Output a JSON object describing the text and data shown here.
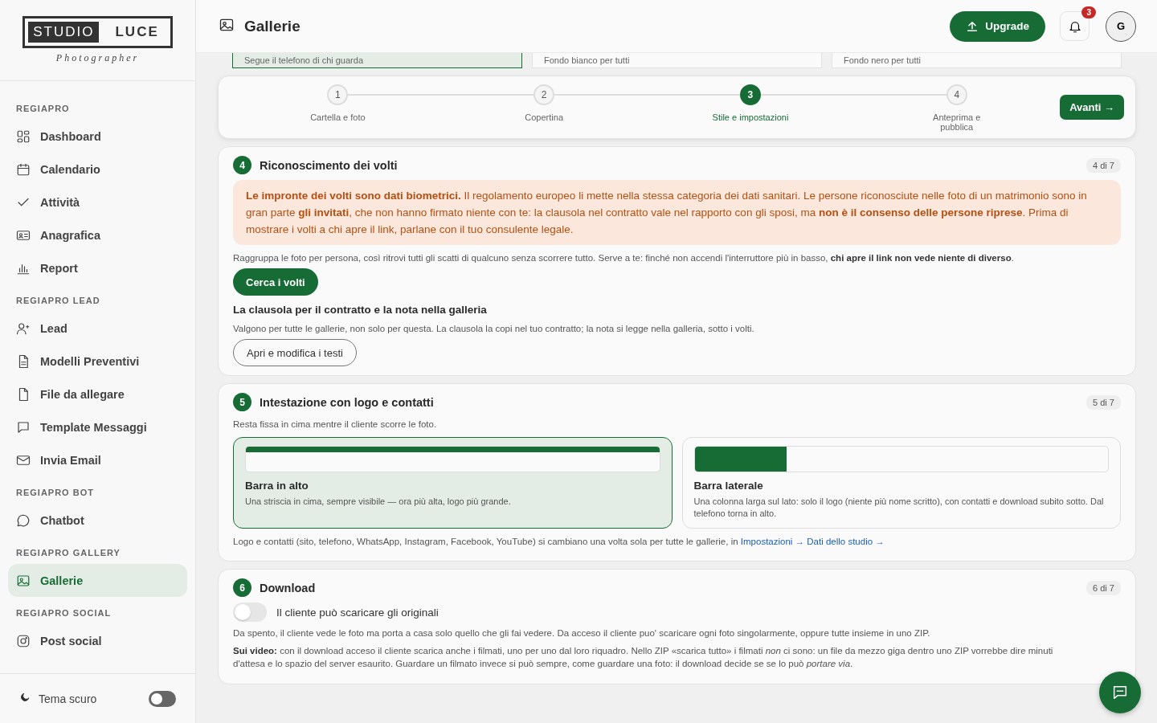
{
  "sidebar": {
    "logo": {
      "boxed": "STUDIO",
      "plain": "LUCE",
      "tagline": "Photographer"
    },
    "groups": [
      {
        "title": "REGIAPRO",
        "items": [
          {
            "label": "Dashboard",
            "selected": false
          },
          {
            "label": "Calendario",
            "selected": false
          },
          {
            "label": "Attività",
            "selected": false
          },
          {
            "label": "Anagrafica",
            "selected": false
          },
          {
            "label": "Report",
            "selected": false
          }
        ]
      },
      {
        "title": "REGIAPRO LEAD",
        "items": [
          {
            "label": "Lead",
            "selected": false
          },
          {
            "label": "Modelli Preventivi",
            "selected": false
          },
          {
            "label": "File da allegare",
            "selected": false
          },
          {
            "label": "Template Messaggi",
            "selected": false
          },
          {
            "label": "Invia Email",
            "selected": false
          }
        ]
      },
      {
        "title": "REGIAPRO BOT",
        "items": [
          {
            "label": "Chatbot",
            "selected": false
          }
        ]
      },
      {
        "title": "REGIAPRO GALLERY",
        "items": [
          {
            "label": "Gallerie",
            "selected": true
          }
        ]
      },
      {
        "title": "REGIAPRO SOCIAL",
        "items": [
          {
            "label": "Post social",
            "selected": false
          }
        ]
      }
    ],
    "dark_theme": {
      "label": "Tema scuro",
      "on": false
    }
  },
  "header": {
    "title": "Gallerie",
    "upgrade": "Upgrade",
    "notifications": "3",
    "avatar": "G"
  },
  "background_options": [
    {
      "text": "Segue il telefono di chi guarda",
      "selected": true
    },
    {
      "text": "Fondo bianco per tutti",
      "selected": false
    },
    {
      "text": "Fondo nero per tutti",
      "selected": false
    }
  ],
  "stepper": {
    "steps": [
      {
        "number": "1",
        "label": "Cartella e foto",
        "selected": false
      },
      {
        "number": "2",
        "label": "Copertina",
        "selected": false
      },
      {
        "number": "3",
        "label": "Stile e impostazioni",
        "selected": true
      },
      {
        "number": "4",
        "label": "Anteprima e pubblica",
        "selected": false
      }
    ],
    "next": "Avanti →"
  },
  "face_section": {
    "number": "4",
    "title": "Riconoscimento dei volti",
    "counter": "4 di 7",
    "warning": "**Le impronte dei volti sono dati biometrici.** Il regolamento europeo li mette nella stessa categoria dei dati sanitari. Le persone riconosciute nelle foto di un matrimonio sono in gran parte **gli invitati**, che non hanno firmato niente con te: la clausola nel contratto vale nel rapporto con gli sposi, ma **non è il consenso delle persone riprese**. Prima di mostrare i volti a chi apre il link, parlane con il tuo consulente legale.",
    "text": "Raggruppa le foto per persona, così ritrovi tutti gli scatti di qualcuno senza scorrere tutto. Serve a te: finché non accendi l'interruttore più in basso, **chi apre il link non vede niente di diverso**.",
    "button": "Cerca i volti",
    "subheading": "La clausola per il contratto e la nota nella galleria",
    "subtext": "Valgono per tutte le gallerie, non solo per questa. La clausola la copi nel tuo contratto; la nota si legge nella galleria, sotto i volti.",
    "edit_button": "Apri e modifica i testi"
  },
  "header_section": {
    "number": "5",
    "title": "Intestazione con logo e contatti",
    "counter": "5 di 7",
    "text": "Resta fissa in cima mentre il cliente scorre le foto.",
    "layouts": [
      {
        "kind": "top",
        "title": "Barra in alto",
        "text": "Una striscia in cima, sempre visibile — ora più alta, logo più grande.",
        "selected": true
      },
      {
        "kind": "side",
        "title": "Barra laterale",
        "text": "Una colonna larga sul lato: solo il logo (niente più nome scritto), con contatti e download subito sotto. Dal telefono torna in alto.",
        "selected": false
      }
    ],
    "note": "Logo e contatti (sito, telefono, WhatsApp, Instagram, Facebook, YouTube) si cambiano una volta sola per tutte le gallerie, in",
    "link": "Impostazioni → Dati dello studio →"
  },
  "download_section": {
    "number": "6",
    "title": "Download",
    "counter": "6 di 7",
    "toggle": {
      "label": "Il cliente può scaricare gli originali",
      "on": false
    },
    "paragraphs": [
      "Da spento, il cliente vede le foto ma porta a casa solo quello che gli fai vedere. Da acceso il cliente puo' scaricare ogni foto singolarmente, oppure tutte insieme in uno ZIP.",
      "**Sui video:** con il download acceso il cliente scarica anche i filmati, uno per uno dal loro riquadro. Nello ZIP «scarica tutto» i filmati *non* ci sono: un file da mezzo giga dentro uno ZIP vorrebbe dire minuti d'attesa e lo spazio del server esaurito. Guardare un filmato invece si può sempre, come guardare una foto: il download decide se se lo può *portare via*."
    ]
  }
}
